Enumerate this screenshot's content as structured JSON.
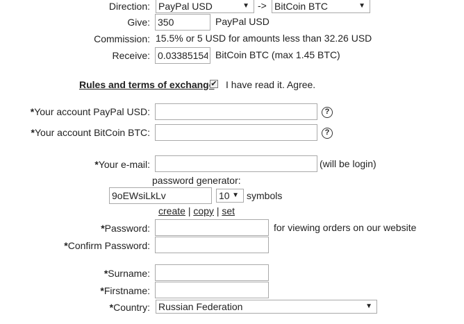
{
  "exchange": {
    "direction_label": "Direction:",
    "from_currency": "PayPal USD",
    "arrow": "->",
    "to_currency": "BitCoin BTC",
    "give_label": "Give:",
    "give_value": "350",
    "give_unit": "PayPal USD",
    "commission_label": "Commission:",
    "commission_text": "15.5% or 5 USD for amounts less than 32.26 USD",
    "receive_label": "Receive:",
    "receive_value": "0.03385154",
    "receive_unit": "BitCoin BTC (max 1.45 BTC)"
  },
  "rules": {
    "link": "Rules and terms of exchange",
    "checked": true,
    "agree_text": "I have read it. Agree."
  },
  "accounts": {
    "star": "*",
    "paypal_label": "Your account PayPal USD:",
    "btc_label": "Your account BitCoin BTC:",
    "help_glyph": "?"
  },
  "login": {
    "email_label": "Your e-mail:",
    "email_note": "(will be login)",
    "generator_label": "password generator:",
    "generated": "9oEWsiLkLv",
    "symbols_count": "10",
    "symbols_label": "symbols",
    "create": "create",
    "copy": "copy",
    "set": "set",
    "sep": "|",
    "password_label": "Password:",
    "password_note": "for viewing orders on our website",
    "confirm_label": "Confirm Password:"
  },
  "personal": {
    "surname_label": "Surname:",
    "firstname_label": "Firstname:",
    "country_label": "Country:",
    "country_value": "Russian Federation"
  },
  "icons": {
    "caret": "▼",
    "check": "✔"
  }
}
